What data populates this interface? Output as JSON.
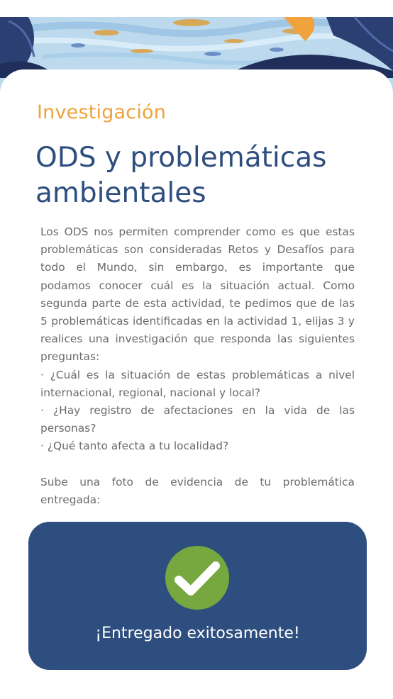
{
  "colors": {
    "accent_orange": "#f0a23c",
    "title_blue": "#2e4e7f",
    "body_gray": "#6b6b6b",
    "panel_blue": "#2e4e7f",
    "check_green": "#77a83f"
  },
  "header": {
    "illustration": "ocean-leaves-illustration"
  },
  "activity": {
    "kicker": "Investigación",
    "title": "ODS y problemáticas ambientales",
    "paragraph": "Los ODS nos permiten comprender como es que estas problemáticas son consideradas Retos y Desafíos para todo el Mundo, sin embargo, es importante que podamos conocer cuál es la situación actual. Como segunda parte de esta actividad, te pedimos que de las 5 problemáticas identificadas en la actividad 1, elijas 3 y realices una investigación que responda las siguientes preguntas:",
    "questions": [
      "·  ¿Cuál es la situación de estas problemáticas a nivel internacional, regional, nacional y local?",
      "·  ¿Hay registro de afectaciones en la vida de las personas?",
      "·  ¿Qué tanto afecta a tu localidad?"
    ],
    "upload_prompt": "Sube una foto de evidencia de tu problemática entregada:"
  },
  "submission": {
    "icon": "check-icon",
    "status": "¡Entregado exitosamente!"
  }
}
